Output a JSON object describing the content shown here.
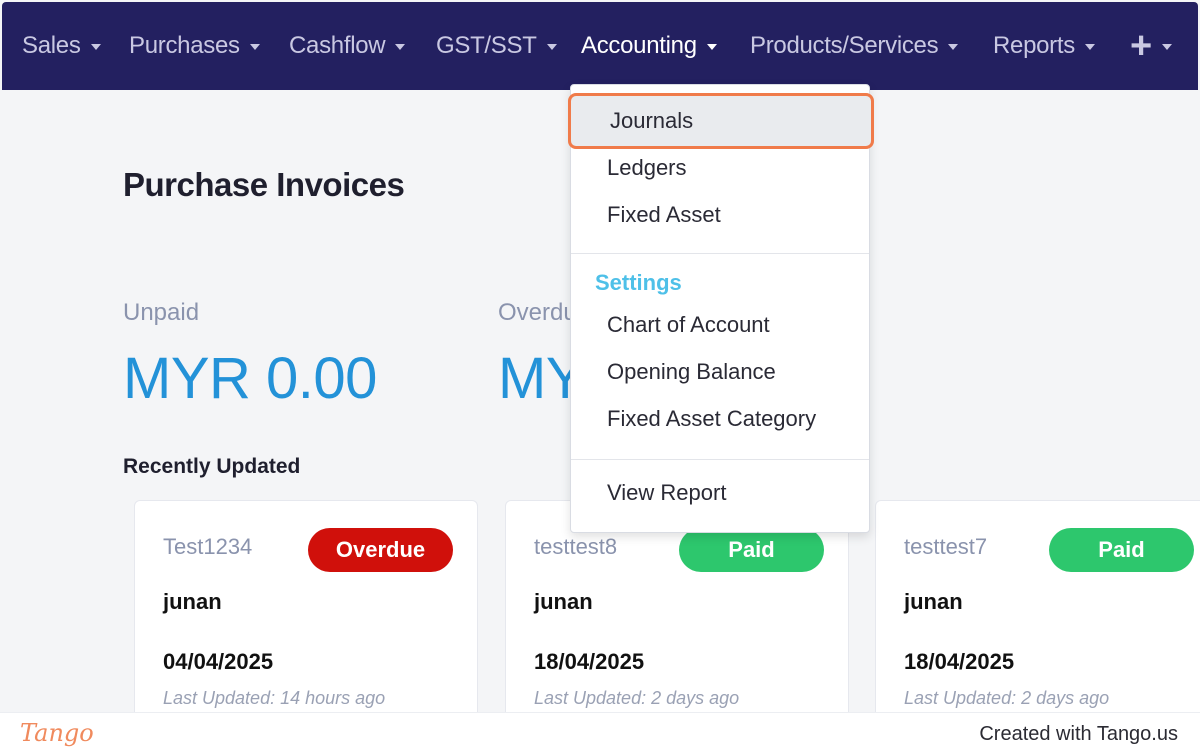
{
  "nav": {
    "items": [
      {
        "label": "Sales"
      },
      {
        "label": "Purchases"
      },
      {
        "label": "Cashflow"
      },
      {
        "label": "GST/SST"
      },
      {
        "label": "Accounting"
      },
      {
        "label": "Products/Services"
      },
      {
        "label": "Reports"
      }
    ],
    "plus": "+"
  },
  "page": {
    "title": "Purchase Invoices",
    "stats": [
      {
        "label": "Unpaid",
        "value": "MYR 0.00"
      },
      {
        "label": "Overdu",
        "value": "MY"
      }
    ],
    "recent_title": "Recently Updated"
  },
  "cards": [
    {
      "ref": "Test1234",
      "status": "Overdue",
      "status_color": "#d0100b",
      "name": "junan",
      "date": "04/04/2025",
      "updated": "Last Updated: 14 hours ago"
    },
    {
      "ref": "testtest8",
      "status": "Paid",
      "status_color": "#2dc76d",
      "name": "junan",
      "date": "18/04/2025",
      "updated": "Last Updated: 2 days ago"
    },
    {
      "ref": "testtest7",
      "status": "Paid",
      "status_color": "#2dc76d",
      "name": "junan",
      "date": "18/04/2025",
      "updated": "Last Updated: 2 days ago"
    }
  ],
  "dropdown": {
    "items": [
      "Journals",
      "Ledgers",
      "Fixed Asset"
    ],
    "settings_header": "Settings",
    "settings_items": [
      "Chart of Account",
      "Opening Balance",
      "Fixed Asset Category"
    ],
    "report_item": "View Report"
  },
  "footer": {
    "logo": "Tango",
    "credit": "Created with Tango.us"
  },
  "colors": {
    "nav_bg": "#232060",
    "accent_blue": "#2392d8",
    "settings_header": "#4ec0e8",
    "highlight_border": "#f07b4a"
  }
}
